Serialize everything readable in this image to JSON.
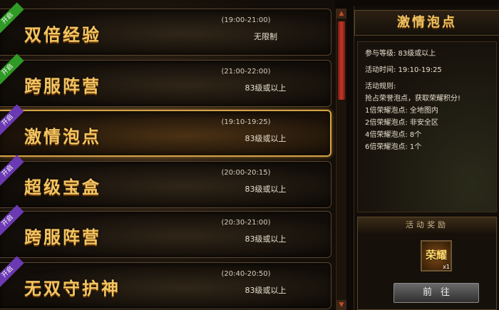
{
  "activities": [
    {
      "name": "双倍经验",
      "time": "(19:00-21:00)",
      "requirement": "无限制",
      "ribbon": "开启",
      "ribbon_color": "green",
      "active": false
    },
    {
      "name": "跨服阵营",
      "time": "(21:00-22:00)",
      "requirement": "83级或以上",
      "ribbon": "开启",
      "ribbon_color": "green",
      "active": false
    },
    {
      "name": "激情泡点",
      "time": "(19:10-19:25)",
      "requirement": "83级或以上",
      "ribbon": "开启",
      "ribbon_color": "purple",
      "active": true
    },
    {
      "name": "超级宝盒",
      "time": "(20:00-20:15)",
      "requirement": "83级或以上",
      "ribbon": "开启",
      "ribbon_color": "purple",
      "active": false
    },
    {
      "name": "跨服阵营",
      "time": "(20:30-21:00)",
      "requirement": "83级或以上",
      "ribbon": "开启",
      "ribbon_color": "purple",
      "active": false
    },
    {
      "name": "无双守护神",
      "time": "(20:40-20:50)",
      "requirement": "83级或以上",
      "ribbon": "开启",
      "ribbon_color": "purple",
      "active": false
    }
  ],
  "detail": {
    "title": "激情泡点",
    "level": "参与等级: 83级或以上",
    "time": "活动时间: 19:10-19:25",
    "rules_heading": "活动规则:",
    "rules": [
      "抢占荣誉泡点，获取荣耀积分!",
      "1倍荣耀泡点: 全地图内",
      "2倍荣耀泡点: 非安全区",
      "4倍荣耀泡点: 8个",
      "6倍荣耀泡点: 1个"
    ],
    "reward_heading": "活动奖励",
    "reward_item": "荣耀",
    "reward_qty": "x1",
    "go_button": "前往"
  },
  "scrollbar": {
    "up": "▲",
    "down": "▼"
  },
  "colors": {
    "gold": "#f3c562",
    "active_border": "#d5a347",
    "ribbon_green": "#2f9a25",
    "ribbon_purple": "#6b39b2"
  }
}
